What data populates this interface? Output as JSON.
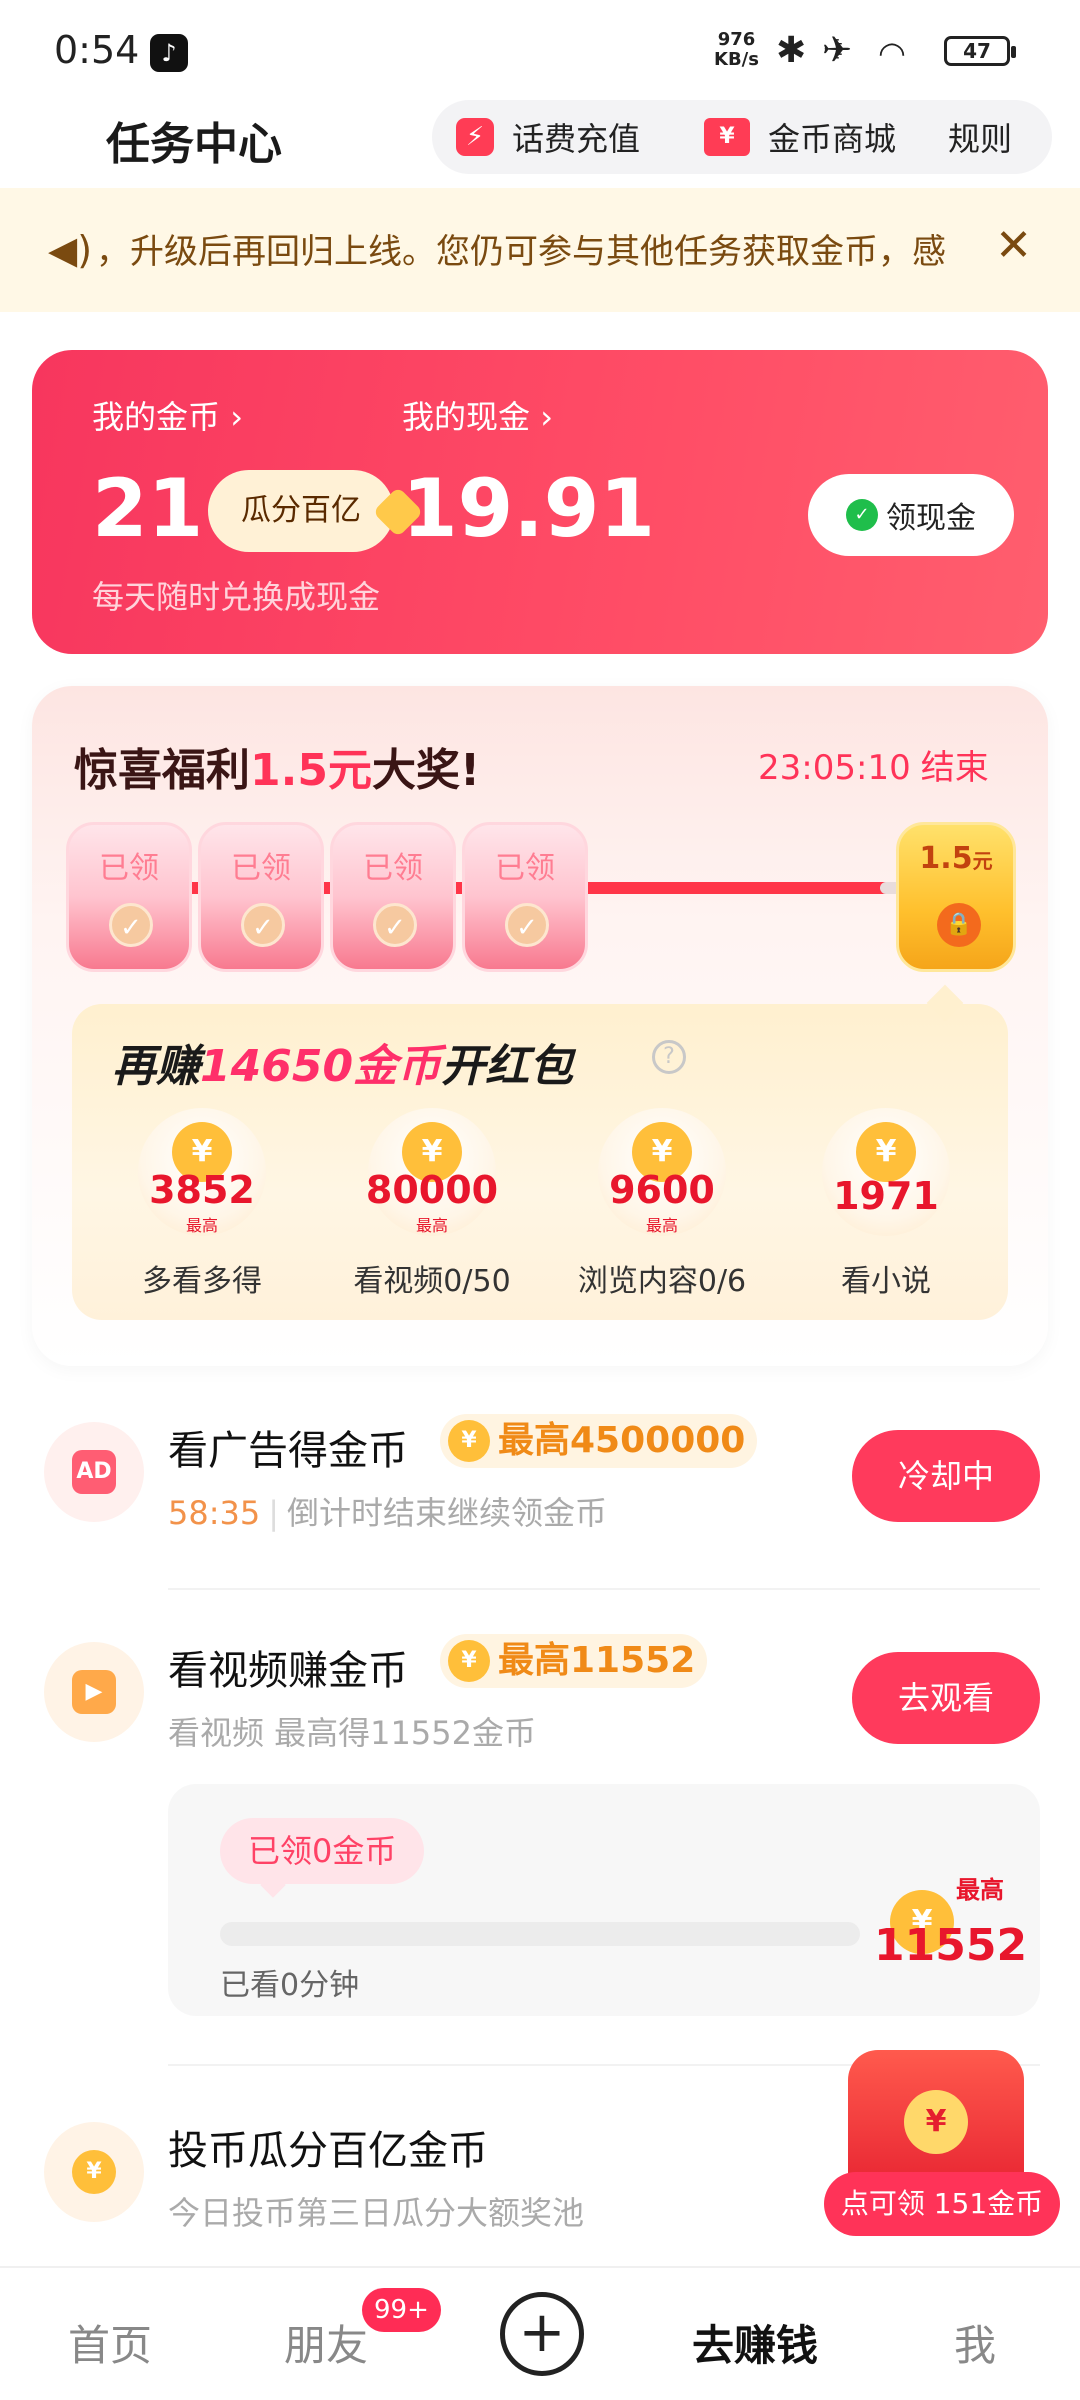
{
  "status_bar": {
    "time": "0:54",
    "app_icon": "tiktok-icon",
    "net_speed_top": "976",
    "net_speed_unit": "KB/s",
    "battery": "47"
  },
  "header": {
    "title": "任务中心",
    "recharge_label": "话费充值",
    "mall_label": "金币商城",
    "rules_label": "规则"
  },
  "notice": {
    "text": "，升级后再回归上线。您仍可参与其他任务获取金币，感"
  },
  "wallet": {
    "coins_label": "我的金币",
    "coins_value": "21",
    "gua_label": "瓜分百亿",
    "coins_sub": "每天随时兑换成现金",
    "cash_label": "我的现金",
    "cash_value": "19.91",
    "cash_button": "领现金"
  },
  "surprise": {
    "title_prefix": "惊喜福利",
    "title_amount": "1.5元",
    "title_suffix": "大奖!",
    "timer": "23:05:10",
    "timer_end": "结束",
    "packets": [
      "已领",
      "已领",
      "已领",
      "已领"
    ],
    "final_amount": "1.5",
    "final_unit": "元",
    "progress_fraction": 0.96
  },
  "earn": {
    "title_prefix": "再赚",
    "title_number": "14650金币",
    "title_suffix": "开红包",
    "max_label": "最高",
    "items": [
      {
        "value": "3852",
        "name": "多看多得",
        "max": "最高"
      },
      {
        "value": "80000",
        "name": "看视频0/50",
        "max": "最高"
      },
      {
        "value": "9600",
        "name": "浏览内容0/6",
        "max": "最高"
      },
      {
        "value": "1971",
        "name": "看小说",
        "max": ""
      }
    ]
  },
  "tasks": {
    "ads": {
      "icon_text": "AD",
      "name": "看广告得金币",
      "badge": "最高4500000",
      "countdown": "58:35",
      "desc": "倒计时结束继续领金币",
      "button": "冷却中"
    },
    "video": {
      "name": "看视频赚金币",
      "badge": "最高11552",
      "desc": "看视频 最高得11552金币",
      "button": "去观看",
      "got_label": "已领0金币",
      "watched_label": "已看0分钟",
      "max_label": "最高",
      "max_value": "11552",
      "progress": 0
    },
    "coin_vote": {
      "name": "投币瓜分百亿金币",
      "desc": "今日投币第三日瓜分大额奖池"
    }
  },
  "floating_gift": {
    "label": "点可领 151金币"
  },
  "bottom_nav": {
    "home": "首页",
    "friends": "朋友",
    "friends_badge": "99+",
    "earn": "去赚钱",
    "me": "我"
  },
  "colors": {
    "accent": "#ff3a5c",
    "coin_gold": "#ffbf3a",
    "notice_bg": "#fff8e6"
  }
}
